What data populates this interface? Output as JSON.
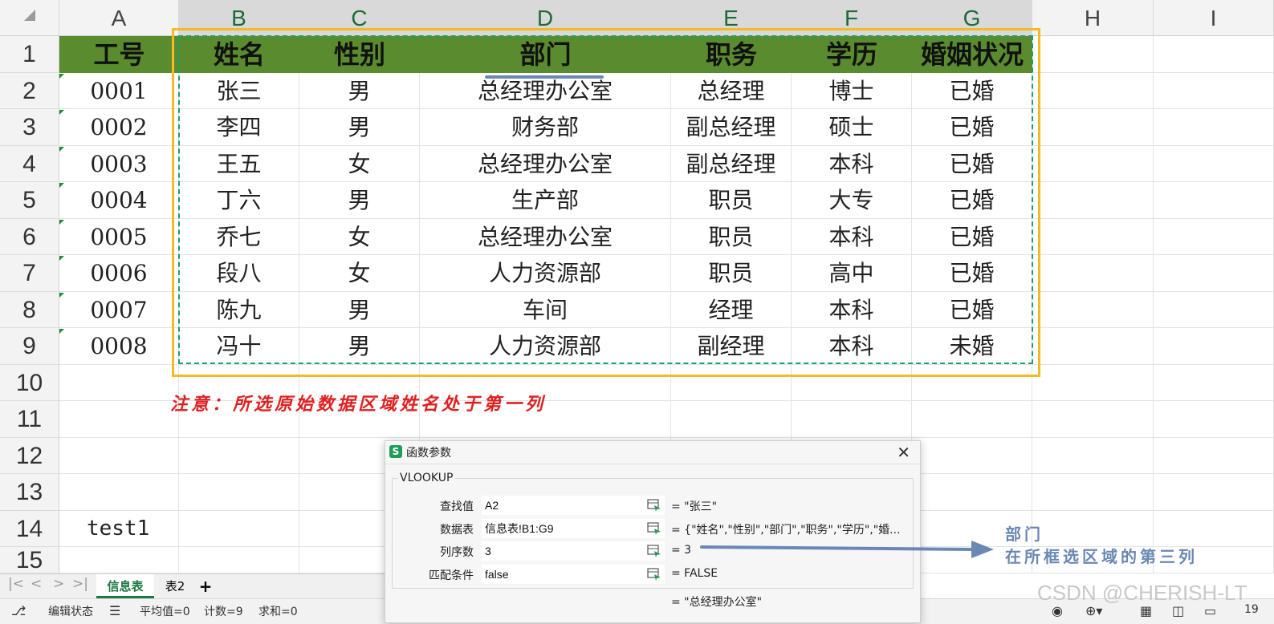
{
  "columns": [
    "A",
    "B",
    "C",
    "D",
    "E",
    "F",
    "G",
    "H",
    "I"
  ],
  "rows": [
    "1",
    "2",
    "3",
    "4",
    "5",
    "6",
    "7",
    "8",
    "9",
    "10",
    "11",
    "12",
    "13",
    "14",
    "15"
  ],
  "table": {
    "header": [
      "工号",
      "姓名",
      "性别",
      "部门",
      "职务",
      "学历",
      "婚姻状况"
    ],
    "data": [
      [
        "0001",
        "张三",
        "男",
        "总经理办公室",
        "总经理",
        "博士",
        "已婚"
      ],
      [
        "0002",
        "李四",
        "男",
        "财务部",
        "副总经理",
        "硕士",
        "已婚"
      ],
      [
        "0003",
        "王五",
        "女",
        "总经理办公室",
        "副总经理",
        "本科",
        "已婚"
      ],
      [
        "0004",
        "丁六",
        "男",
        "生产部",
        "职员",
        "大专",
        "已婚"
      ],
      [
        "0005",
        "乔七",
        "女",
        "总经理办公室",
        "职员",
        "本科",
        "已婚"
      ],
      [
        "0006",
        "段八",
        "女",
        "人力资源部",
        "职员",
        "高中",
        "已婚"
      ],
      [
        "0007",
        "陈九",
        "男",
        "车间",
        "经理",
        "本科",
        "已婚"
      ],
      [
        "0008",
        "冯十",
        "男",
        "人力资源部",
        "副经理",
        "本科",
        "未婚"
      ]
    ]
  },
  "note": "注意：所选原始数据区域姓名处于第一列",
  "cell_a14": "test1",
  "sheets": {
    "active": "信息表",
    "other": "表2",
    "add": "+"
  },
  "nav": [
    "|<",
    "<",
    ">",
    ">|"
  ],
  "status": {
    "mode": "编辑状态",
    "avg": "平均值=0",
    "count": "计数=9",
    "sum": "求和=0",
    "zoom": "19"
  },
  "dialog": {
    "title": "函数参数",
    "function": "VLOOKUP",
    "params": [
      {
        "label": "查找值",
        "value": "A2",
        "preview": "= \"张三\""
      },
      {
        "label": "数据表",
        "value": "信息表!B1:G9",
        "preview": "= {\"姓名\",\"性别\",\"部门\",\"职务\",\"学历\",\"婚..."
      },
      {
        "label": "列序数",
        "value": "3",
        "preview": "= 3"
      },
      {
        "label": "匹配条件",
        "value": "false",
        "preview": "= FALSE"
      }
    ],
    "result": "= \"总经理办公室\""
  },
  "annotation": {
    "line1": "部门",
    "line2": "在所框选区域的第三列"
  },
  "watermark": "CSDN @CHERISH-LT",
  "colors": {
    "header_green": "#5a8c2f",
    "orange_box": "#f5b921",
    "dash_green": "#1aa06a",
    "note_red": "#e02020",
    "arrow_blue": "#6a88b4"
  }
}
